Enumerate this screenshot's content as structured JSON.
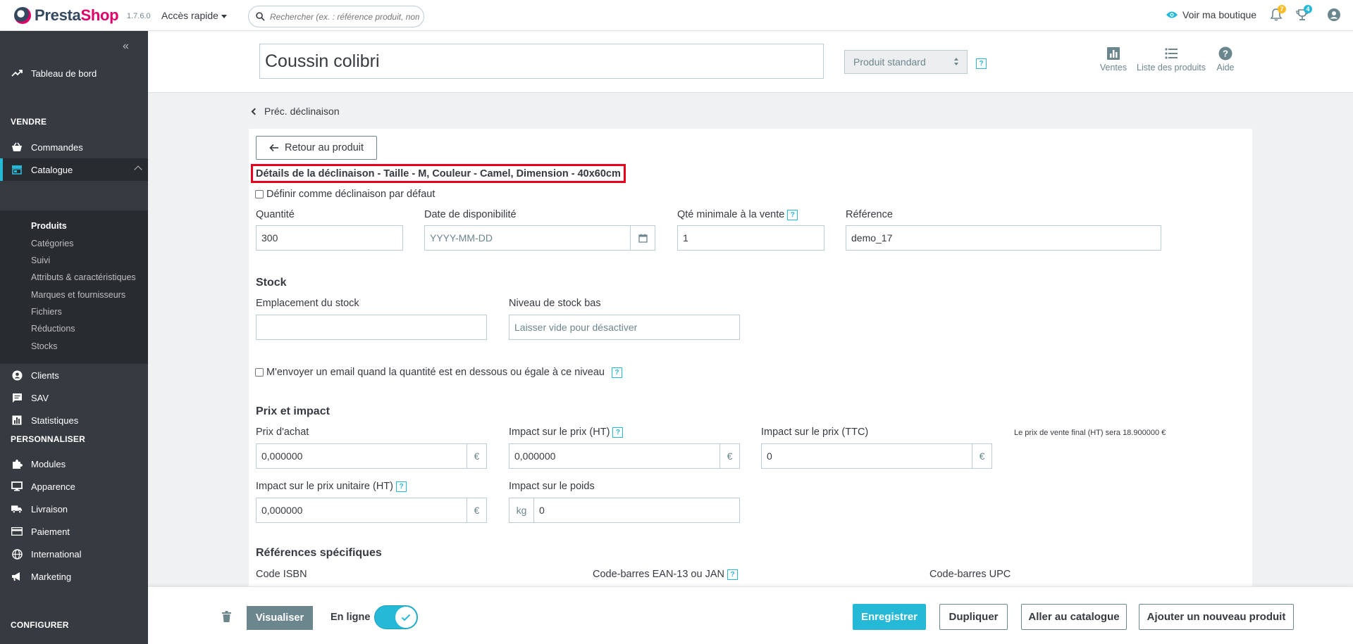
{
  "header": {
    "logo_text_a": "Presta",
    "logo_text_b": "Shop",
    "version": "1.7.6.0",
    "quick_access": "Accès rapide",
    "search_placeholder": "Rechercher (ex. : référence produit, nom",
    "view_shop": "Voir ma boutique",
    "notif_orders": "7",
    "notif_customers": "4"
  },
  "sidebar": {
    "dashboard": "Tableau de bord",
    "section_sell": "VENDRE",
    "orders": "Commandes",
    "catalog": "Catalogue",
    "catalog_sub": [
      "Produits",
      "Catégories",
      "Suivi",
      "Attributs & caractéristiques",
      "Marques et fournisseurs",
      "Fichiers",
      "Réductions",
      "Stocks"
    ],
    "customers": "Clients",
    "sav": "SAV",
    "stats": "Statistiques",
    "section_custom": "PERSONNALISER",
    "modules": "Modules",
    "appearance": "Apparence",
    "shipping": "Livraison",
    "payment": "Paiement",
    "international": "International",
    "marketing": "Marketing",
    "section_config": "CONFIGURER"
  },
  "product_header": {
    "name": "Coussin colibri",
    "type": "Produit standard",
    "actions": {
      "sales": "Ventes",
      "product_list": "Liste des produits",
      "help": "Aide"
    }
  },
  "content": {
    "prev_variant": "Préc. déclinaison",
    "back_to_product": "Retour au produit",
    "variant_title": "Détails de la déclinaison - Taille - M, Couleur - Camel, Dimension - 40x60cm",
    "default_variant": "Définir comme déclinaison par défaut",
    "quantity_label": "Quantité",
    "quantity_value": "300",
    "availability_label": "Date de disponibilité",
    "availability_placeholder": "YYYY-MM-DD",
    "min_qty_label": "Qté minimale à la vente",
    "min_qty_value": "1",
    "reference_label": "Référence",
    "reference_value": "demo_17",
    "stock_heading": "Stock",
    "stock_location_label": "Emplacement du stock",
    "stock_location_value": "",
    "low_stock_label": "Niveau de stock bas",
    "low_stock_placeholder": "Laisser vide pour désactiver",
    "email_alert": "M'envoyer un email quand la quantité est en dessous ou égale à ce niveau",
    "price_heading": "Prix et impact",
    "purchase_price_label": "Prix d'achat",
    "purchase_price_value": "0,000000",
    "impact_ht_label": "Impact sur le prix (HT)",
    "impact_ht_value": "0,000000",
    "impact_ttc_label": "Impact sur le prix (TTC)",
    "impact_ttc_value": "0",
    "final_price_note": "Le prix de vente final (HT) sera 18.900000 €",
    "unit_impact_label": "Impact sur le prix unitaire (HT)",
    "unit_impact_value": "0,000000",
    "weight_impact_label": "Impact sur le poids",
    "weight_unit": "kg",
    "weight_value": "0",
    "currency": "€",
    "refs_heading": "Références spécifiques",
    "isbn_label": "Code ISBN",
    "ean_label": "Code-barres EAN-13 ou JAN",
    "upc_label": "Code-barres UPC",
    "help_mark": "?"
  },
  "footer": {
    "preview": "Visualiser",
    "online": "En ligne",
    "save": "Enregistrer",
    "duplicate": "Dupliquer",
    "go_catalog": "Aller au catalogue",
    "add_new": "Ajouter un nouveau produit"
  },
  "colors": {
    "accent": "#25b9d7",
    "sidebar": "#363a41",
    "brand_pink": "#df0067",
    "highlight": "#e8001c"
  }
}
